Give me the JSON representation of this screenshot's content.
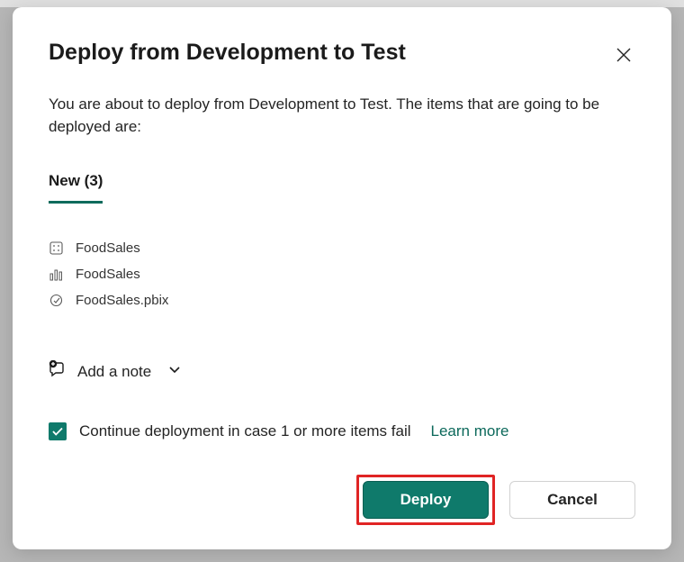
{
  "dialog": {
    "title": "Deploy from Development to Test",
    "description": "You are about to deploy from Development to Test. The items that are going to be deployed are:",
    "tab_label": "New (3)",
    "items": [
      {
        "icon": "dataset",
        "name": "FoodSales"
      },
      {
        "icon": "report",
        "name": "FoodSales"
      },
      {
        "icon": "file",
        "name": "FoodSales.pbix"
      }
    ],
    "add_note_label": "Add a note",
    "continue_label": "Continue deployment in case 1 or more items fail",
    "learn_more_label": "Learn more",
    "deploy_label": "Deploy",
    "cancel_label": "Cancel",
    "continue_checked": true
  }
}
